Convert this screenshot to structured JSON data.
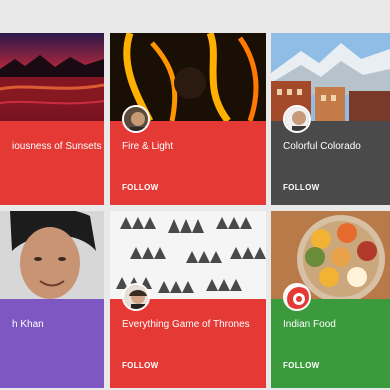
{
  "colors": {
    "red": "#e53935",
    "gray": "#4a4a4a",
    "purple": "#7e57c2",
    "green": "#3a9a3c"
  },
  "cards": [
    {
      "title": "iousness of Sunsets",
      "follow": ""
    },
    {
      "title": "Fire & Light",
      "follow": "FOLLOW"
    },
    {
      "title": "Colorful Colorado",
      "follow": "FOLLOW"
    },
    {
      "title": "h Khan",
      "follow": ""
    },
    {
      "title": "Everything Game of Thrones",
      "follow": "FOLLOW"
    },
    {
      "title": "Indian Food",
      "follow": "FOLLOW"
    }
  ]
}
